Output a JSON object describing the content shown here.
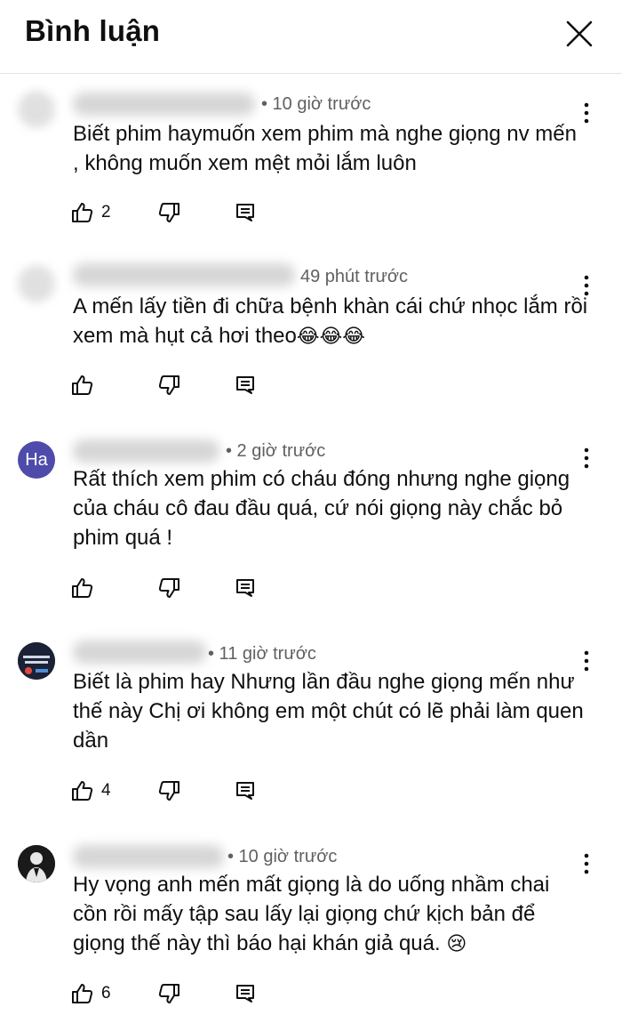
{
  "header": {
    "title": "Bình luận"
  },
  "icons": {
    "close": "close-icon",
    "like": "thumbs-up-icon",
    "dislike": "thumbs-down-icon",
    "reply": "reply-icon",
    "more": "more-vertical-icon"
  },
  "comments": [
    {
      "time": "• 10 giờ trước",
      "text": "Biết phim haymuốn xem phim mà nghe giọng nv mến , không muốn xem mệt mỏi lắm luôn",
      "likes": "2"
    },
    {
      "time": "49 phút trước",
      "text": "A mến lấy tiền đi chữa bệnh khàn cái chứ nhọc lắm rồi xem mà hụt cả hơi theo",
      "emoji": "😂😂😂",
      "likes": ""
    },
    {
      "avatar_letter": "Ha",
      "time": "• 2 giờ trước",
      "text": "Rất thích xem phim có cháu đóng nhưng nghe giọng của cháu cô đau đầu quá, cứ nói giọng này chắc bỏ phim quá !",
      "likes": ""
    },
    {
      "time": "• 11 giờ trước",
      "text": "Biết là phim hay Nhưng lần đầu nghe giọng mến như thế này Chị ơi không em một chút có lẽ phải làm quen dần",
      "likes": "4"
    },
    {
      "time": "• 10 giờ trước",
      "text": "Hy vọng anh mến mất giọng là do uống nhầm chai cồn rồi mấy tập sau lấy lại giọng chứ kịch bản để giọng thế này thì báo hại khán giả quá.",
      "emoji": "😢",
      "likes": "6"
    }
  ]
}
